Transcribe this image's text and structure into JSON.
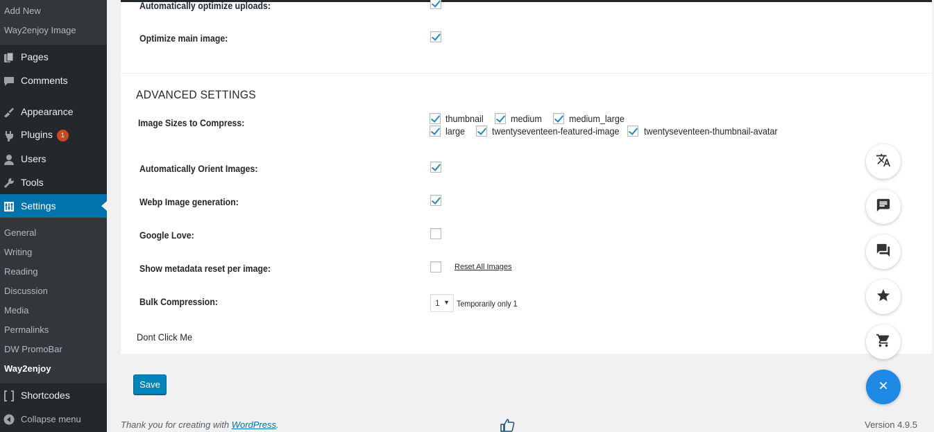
{
  "sidebar": {
    "media_sub": [
      "Add New",
      "Way2enjoy Image"
    ],
    "items": [
      {
        "label": "Pages",
        "icon": "pages-icon"
      },
      {
        "label": "Comments",
        "icon": "comments-icon"
      },
      {
        "label": "Appearance",
        "icon": "appearance-icon"
      },
      {
        "label": "Plugins",
        "icon": "plugins-icon",
        "badge": "1"
      },
      {
        "label": "Users",
        "icon": "users-icon"
      },
      {
        "label": "Tools",
        "icon": "tools-icon"
      },
      {
        "label": "Settings",
        "icon": "settings-icon"
      }
    ],
    "settings_sub": [
      "General",
      "Writing",
      "Reading",
      "Discussion",
      "Media",
      "Permalinks",
      "DW PromoBar",
      "Way2enjoy"
    ],
    "shortcodes": "Shortcodes",
    "collapse": "Collapse menu"
  },
  "top": {
    "auto_optimize_label": "Automatically optimize uploads:",
    "optimize_main_label": "Optimize main image:"
  },
  "advanced": {
    "heading": "ADVANCED SETTINGS",
    "image_sizes_label": "Image Sizes to Compress:",
    "sizes": [
      "thumbnail",
      "medium",
      "medium_large",
      "large",
      "twentyseventeen-featured-image",
      "twentyseventeen-thumbnail-avatar"
    ],
    "orient_label": "Automatically Orient Images:",
    "webp_label": "Webp Image generation:",
    "google_label": "Google Love:",
    "metadata_label": "Show metadata reset per image:",
    "reset_link": "Reset All Images",
    "bulk_label": "Bulk Compression:",
    "bulk_value": "1",
    "bulk_note": "Temporarily only 1",
    "dont_click": "Dont Click Me"
  },
  "save_label": "Save",
  "footer": {
    "thanks_prefix": "Thank you for creating with ",
    "wp_link": "WordPress",
    "thanks_suffix": ".",
    "version": "Version 4.9.5"
  },
  "fabs": [
    "translate-icon",
    "chat-icon",
    "forum-icon",
    "star-icon",
    "cart-icon",
    "close-icon"
  ],
  "colors": {
    "accent": "#0073aa",
    "sidebar": "#23282d",
    "fab_main": "#1e88e5",
    "badge": "#ca4a1f"
  }
}
